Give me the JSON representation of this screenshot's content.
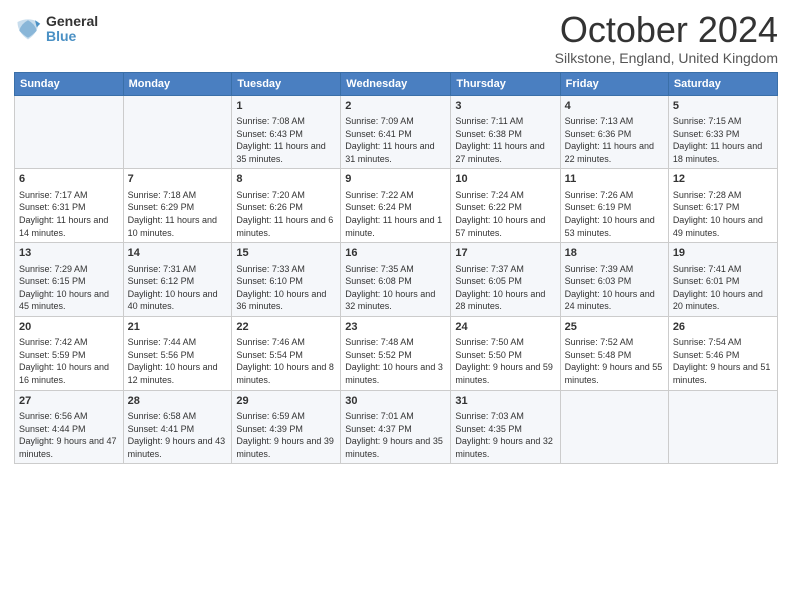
{
  "logo": {
    "general": "General",
    "blue": "Blue"
  },
  "title": "October 2024",
  "location": "Silkstone, England, United Kingdom",
  "headers": [
    "Sunday",
    "Monday",
    "Tuesday",
    "Wednesday",
    "Thursday",
    "Friday",
    "Saturday"
  ],
  "weeks": [
    [
      {
        "day": "",
        "sunrise": "",
        "sunset": "",
        "daylight": ""
      },
      {
        "day": "",
        "sunrise": "",
        "sunset": "",
        "daylight": ""
      },
      {
        "day": "1",
        "sunrise": "Sunrise: 7:08 AM",
        "sunset": "Sunset: 6:43 PM",
        "daylight": "Daylight: 11 hours and 35 minutes."
      },
      {
        "day": "2",
        "sunrise": "Sunrise: 7:09 AM",
        "sunset": "Sunset: 6:41 PM",
        "daylight": "Daylight: 11 hours and 31 minutes."
      },
      {
        "day": "3",
        "sunrise": "Sunrise: 7:11 AM",
        "sunset": "Sunset: 6:38 PM",
        "daylight": "Daylight: 11 hours and 27 minutes."
      },
      {
        "day": "4",
        "sunrise": "Sunrise: 7:13 AM",
        "sunset": "Sunset: 6:36 PM",
        "daylight": "Daylight: 11 hours and 22 minutes."
      },
      {
        "day": "5",
        "sunrise": "Sunrise: 7:15 AM",
        "sunset": "Sunset: 6:33 PM",
        "daylight": "Daylight: 11 hours and 18 minutes."
      }
    ],
    [
      {
        "day": "6",
        "sunrise": "Sunrise: 7:17 AM",
        "sunset": "Sunset: 6:31 PM",
        "daylight": "Daylight: 11 hours and 14 minutes."
      },
      {
        "day": "7",
        "sunrise": "Sunrise: 7:18 AM",
        "sunset": "Sunset: 6:29 PM",
        "daylight": "Daylight: 11 hours and 10 minutes."
      },
      {
        "day": "8",
        "sunrise": "Sunrise: 7:20 AM",
        "sunset": "Sunset: 6:26 PM",
        "daylight": "Daylight: 11 hours and 6 minutes."
      },
      {
        "day": "9",
        "sunrise": "Sunrise: 7:22 AM",
        "sunset": "Sunset: 6:24 PM",
        "daylight": "Daylight: 11 hours and 1 minute."
      },
      {
        "day": "10",
        "sunrise": "Sunrise: 7:24 AM",
        "sunset": "Sunset: 6:22 PM",
        "daylight": "Daylight: 10 hours and 57 minutes."
      },
      {
        "day": "11",
        "sunrise": "Sunrise: 7:26 AM",
        "sunset": "Sunset: 6:19 PM",
        "daylight": "Daylight: 10 hours and 53 minutes."
      },
      {
        "day": "12",
        "sunrise": "Sunrise: 7:28 AM",
        "sunset": "Sunset: 6:17 PM",
        "daylight": "Daylight: 10 hours and 49 minutes."
      }
    ],
    [
      {
        "day": "13",
        "sunrise": "Sunrise: 7:29 AM",
        "sunset": "Sunset: 6:15 PM",
        "daylight": "Daylight: 10 hours and 45 minutes."
      },
      {
        "day": "14",
        "sunrise": "Sunrise: 7:31 AM",
        "sunset": "Sunset: 6:12 PM",
        "daylight": "Daylight: 10 hours and 40 minutes."
      },
      {
        "day": "15",
        "sunrise": "Sunrise: 7:33 AM",
        "sunset": "Sunset: 6:10 PM",
        "daylight": "Daylight: 10 hours and 36 minutes."
      },
      {
        "day": "16",
        "sunrise": "Sunrise: 7:35 AM",
        "sunset": "Sunset: 6:08 PM",
        "daylight": "Daylight: 10 hours and 32 minutes."
      },
      {
        "day": "17",
        "sunrise": "Sunrise: 7:37 AM",
        "sunset": "Sunset: 6:05 PM",
        "daylight": "Daylight: 10 hours and 28 minutes."
      },
      {
        "day": "18",
        "sunrise": "Sunrise: 7:39 AM",
        "sunset": "Sunset: 6:03 PM",
        "daylight": "Daylight: 10 hours and 24 minutes."
      },
      {
        "day": "19",
        "sunrise": "Sunrise: 7:41 AM",
        "sunset": "Sunset: 6:01 PM",
        "daylight": "Daylight: 10 hours and 20 minutes."
      }
    ],
    [
      {
        "day": "20",
        "sunrise": "Sunrise: 7:42 AM",
        "sunset": "Sunset: 5:59 PM",
        "daylight": "Daylight: 10 hours and 16 minutes."
      },
      {
        "day": "21",
        "sunrise": "Sunrise: 7:44 AM",
        "sunset": "Sunset: 5:56 PM",
        "daylight": "Daylight: 10 hours and 12 minutes."
      },
      {
        "day": "22",
        "sunrise": "Sunrise: 7:46 AM",
        "sunset": "Sunset: 5:54 PM",
        "daylight": "Daylight: 10 hours and 8 minutes."
      },
      {
        "day": "23",
        "sunrise": "Sunrise: 7:48 AM",
        "sunset": "Sunset: 5:52 PM",
        "daylight": "Daylight: 10 hours and 3 minutes."
      },
      {
        "day": "24",
        "sunrise": "Sunrise: 7:50 AM",
        "sunset": "Sunset: 5:50 PM",
        "daylight": "Daylight: 9 hours and 59 minutes."
      },
      {
        "day": "25",
        "sunrise": "Sunrise: 7:52 AM",
        "sunset": "Sunset: 5:48 PM",
        "daylight": "Daylight: 9 hours and 55 minutes."
      },
      {
        "day": "26",
        "sunrise": "Sunrise: 7:54 AM",
        "sunset": "Sunset: 5:46 PM",
        "daylight": "Daylight: 9 hours and 51 minutes."
      }
    ],
    [
      {
        "day": "27",
        "sunrise": "Sunrise: 6:56 AM",
        "sunset": "Sunset: 4:44 PM",
        "daylight": "Daylight: 9 hours and 47 minutes."
      },
      {
        "day": "28",
        "sunrise": "Sunrise: 6:58 AM",
        "sunset": "Sunset: 4:41 PM",
        "daylight": "Daylight: 9 hours and 43 minutes."
      },
      {
        "day": "29",
        "sunrise": "Sunrise: 6:59 AM",
        "sunset": "Sunset: 4:39 PM",
        "daylight": "Daylight: 9 hours and 39 minutes."
      },
      {
        "day": "30",
        "sunrise": "Sunrise: 7:01 AM",
        "sunset": "Sunset: 4:37 PM",
        "daylight": "Daylight: 9 hours and 35 minutes."
      },
      {
        "day": "31",
        "sunrise": "Sunrise: 7:03 AM",
        "sunset": "Sunset: 4:35 PM",
        "daylight": "Daylight: 9 hours and 32 minutes."
      },
      {
        "day": "",
        "sunrise": "",
        "sunset": "",
        "daylight": ""
      },
      {
        "day": "",
        "sunrise": "",
        "sunset": "",
        "daylight": ""
      }
    ]
  ]
}
